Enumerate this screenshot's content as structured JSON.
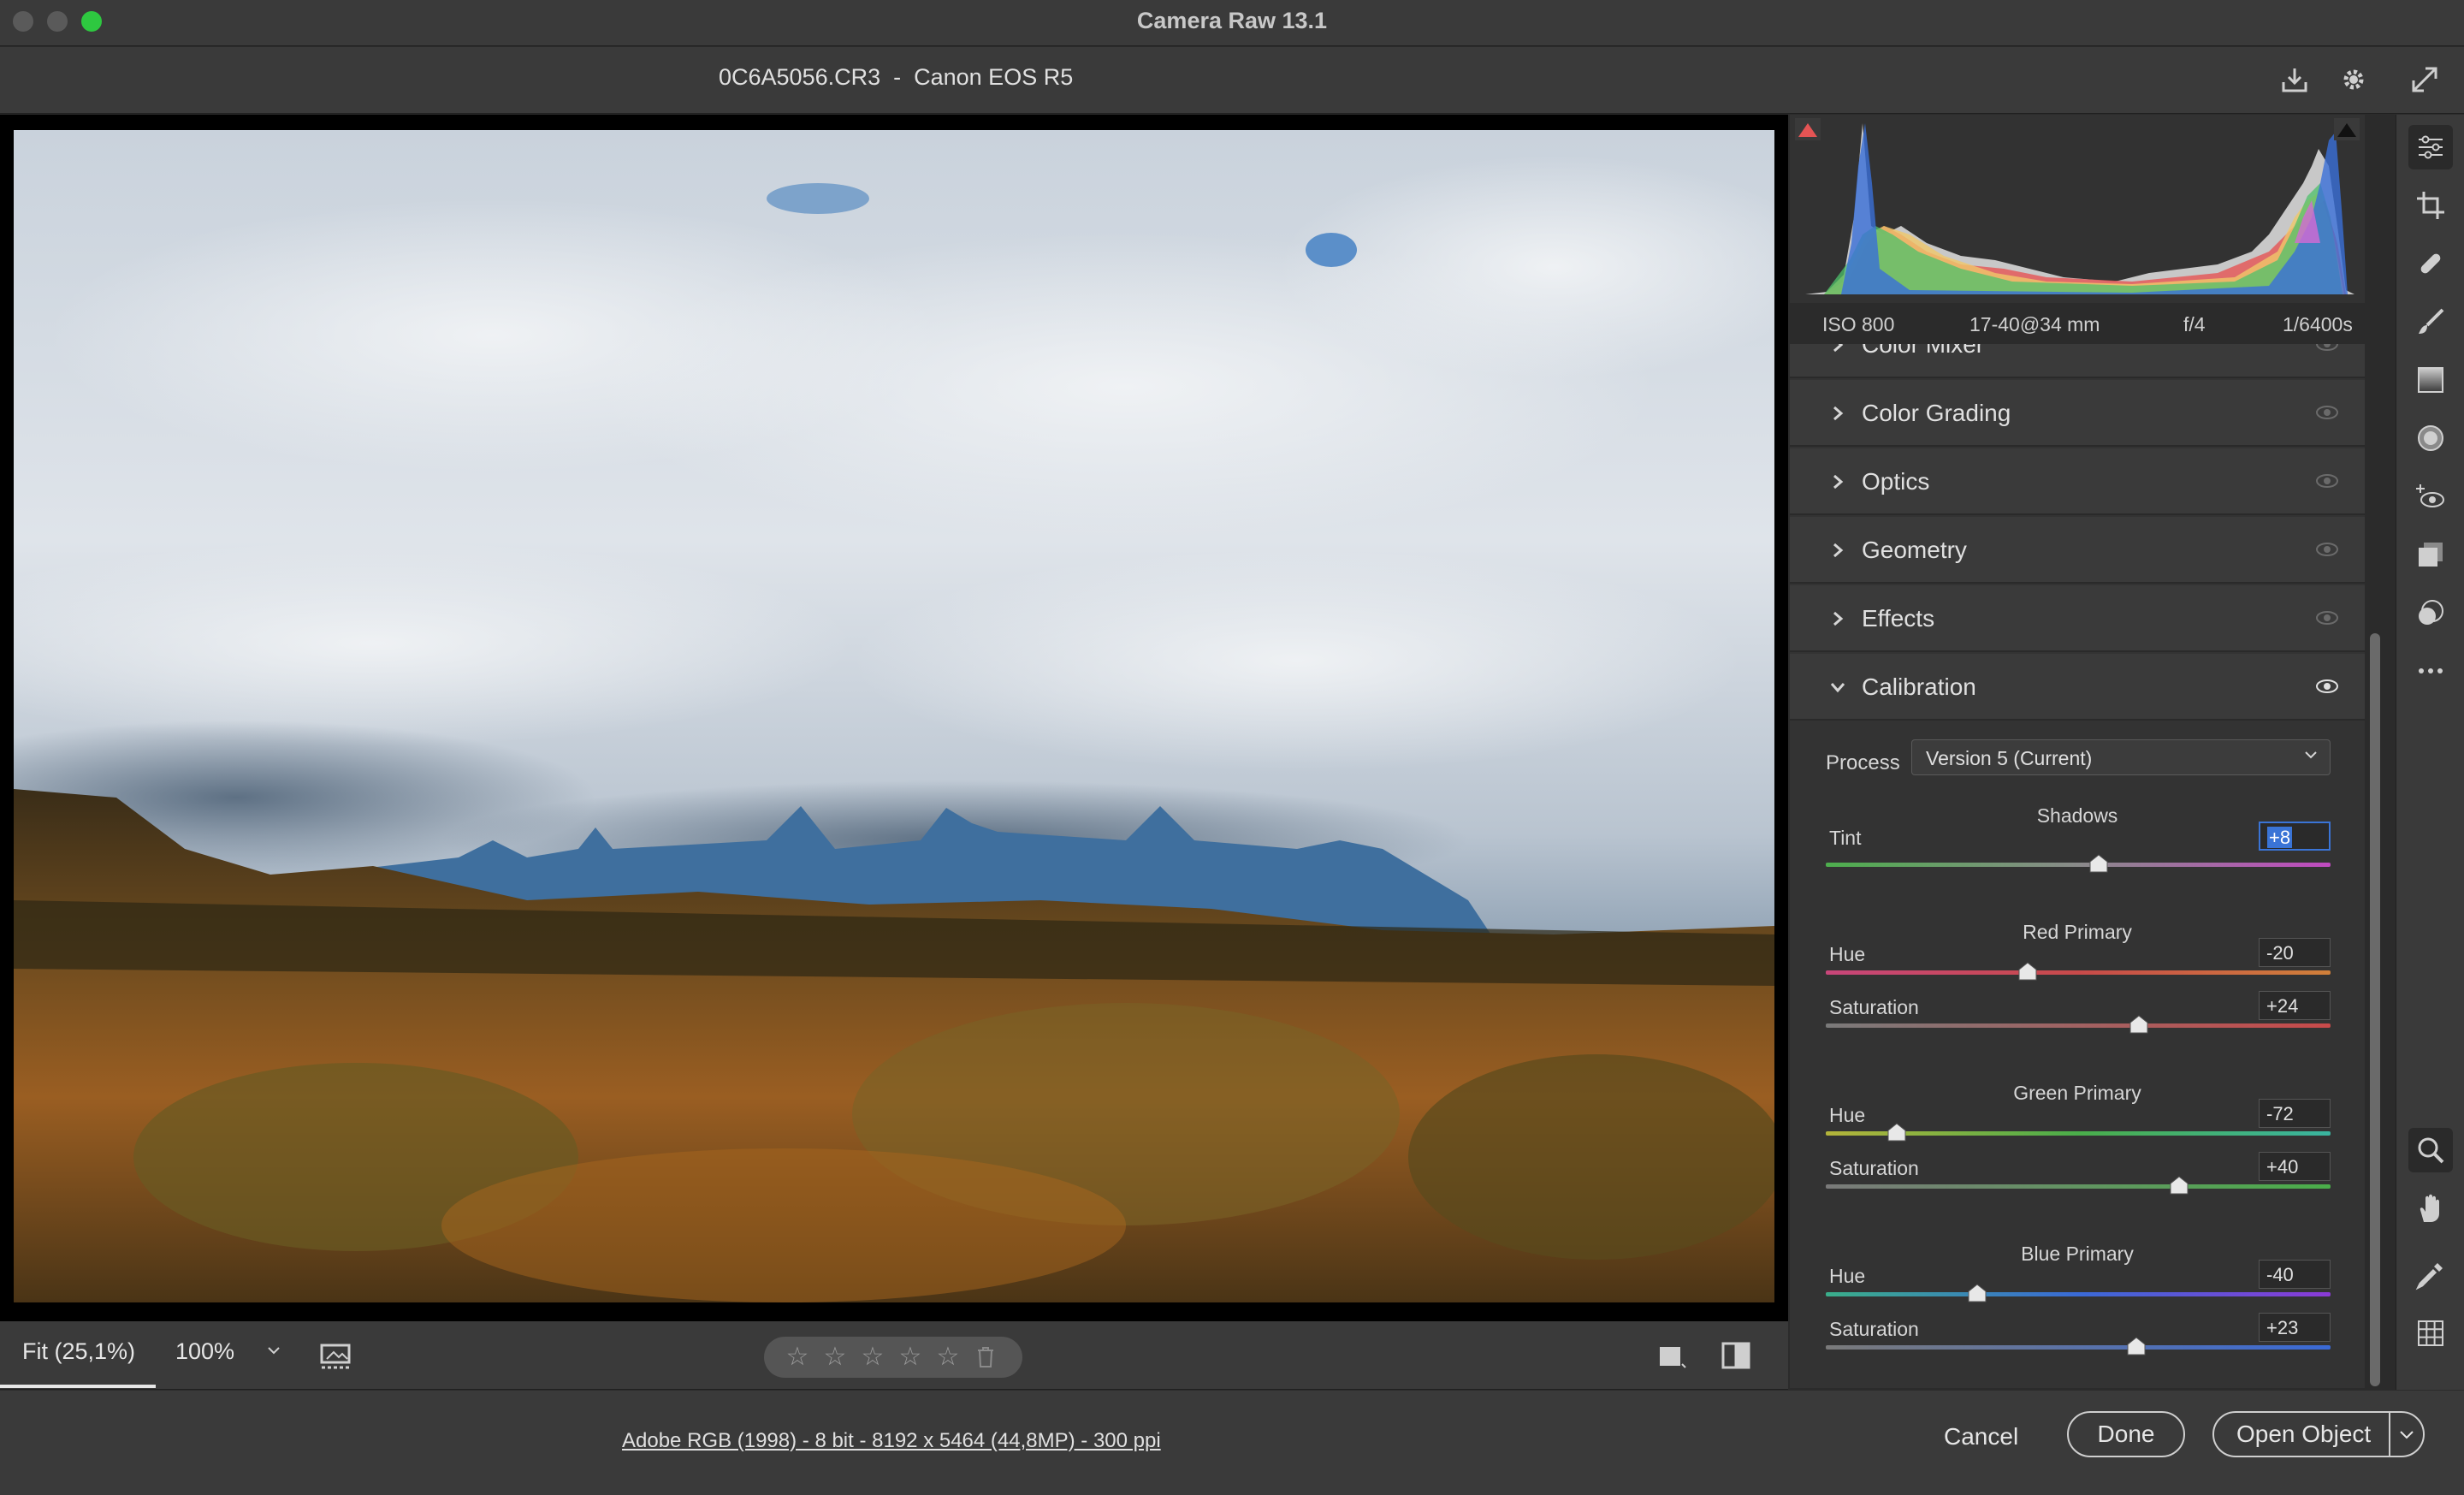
{
  "window": {
    "title": "Camera Raw 13.1"
  },
  "header": {
    "file_title": "0C6A5056.CR3  -  Canon EOS R5"
  },
  "exif": {
    "iso": "ISO 800",
    "lens": "17-40@34 mm",
    "aperture": "f/4",
    "shutter": "1/6400s"
  },
  "sections": [
    {
      "title": "Color Mixer",
      "expanded": false
    },
    {
      "title": "Color Grading",
      "expanded": false
    },
    {
      "title": "Optics",
      "expanded": false
    },
    {
      "title": "Geometry",
      "expanded": false
    },
    {
      "title": "Effects",
      "expanded": false
    },
    {
      "title": "Calibration",
      "expanded": true
    }
  ],
  "calibration": {
    "process_label": "Process",
    "process_value": "Version 5 (Current)",
    "shadows": {
      "title": "Shadows",
      "tint_label": "Tint",
      "tint_value": "+8",
      "tint": 8
    },
    "red": {
      "title": "Red Primary",
      "hue_label": "Hue",
      "hue_value": "-20",
      "hue": -20,
      "sat_label": "Saturation",
      "sat_value": "+24",
      "sat": 24
    },
    "green": {
      "title": "Green Primary",
      "hue_label": "Hue",
      "hue_value": "-72",
      "hue": -72,
      "sat_label": "Saturation",
      "sat_value": "+40",
      "sat": 40
    },
    "blue": {
      "title": "Blue Primary",
      "hue_label": "Hue",
      "hue_value": "-40",
      "hue": -40,
      "sat_label": "Saturation",
      "sat_value": "+23",
      "sat": 23
    }
  },
  "image_toolbar": {
    "fit_label": "Fit (25,1%)",
    "zoom_label": "100%",
    "rating": 0
  },
  "footer": {
    "workflow": "Adobe RGB (1998) - 8 bit - 8192 x 5464 (44,8MP) - 300 ppi",
    "cancel": "Cancel",
    "done": "Done",
    "open": "Open Object"
  },
  "colors": {
    "accent": "#3a74d6",
    "bg": "#2b2b2b",
    "panel": "#3a3a3a"
  }
}
